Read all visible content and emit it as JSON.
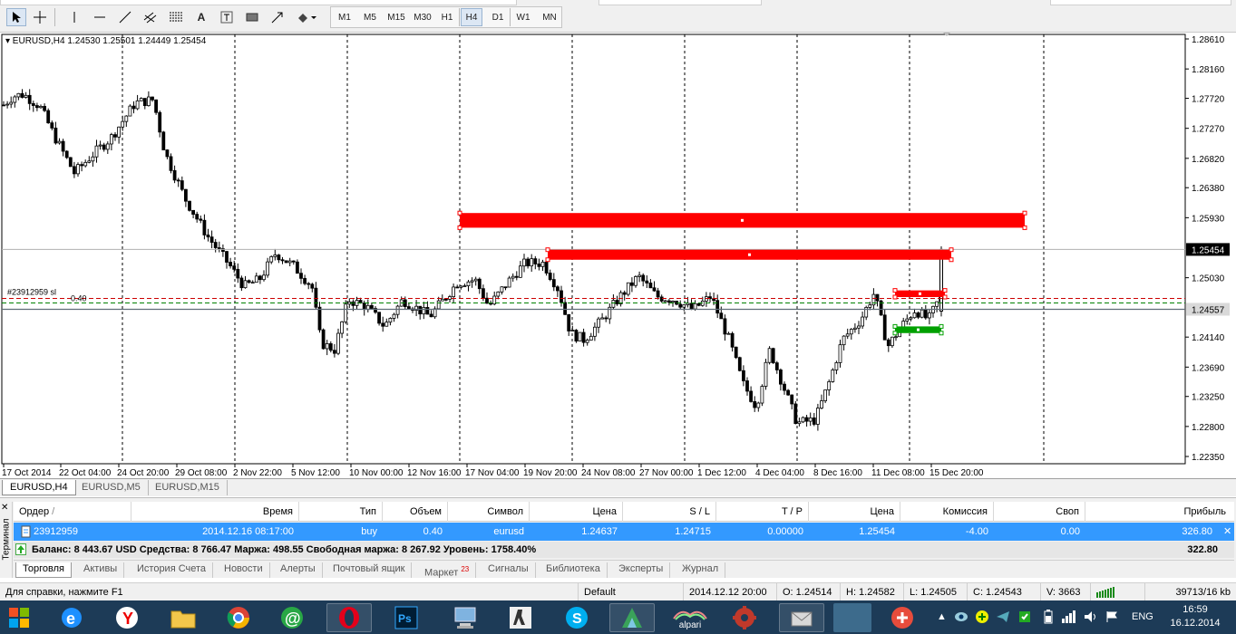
{
  "toolbar": {
    "timeframes": [
      "M1",
      "M5",
      "M15",
      "M30",
      "H1",
      "H4",
      "D1",
      "W1",
      "MN"
    ],
    "selected_timeframe": "H4"
  },
  "chart": {
    "info": "EURUSD,H4  1.24530 1.25501 1.24449 1.25454",
    "price_labels": [
      "1.28610",
      "1.28160",
      "1.27720",
      "1.27270",
      "1.26820",
      "1.26380",
      "1.25930",
      "1.25030",
      "1.24140",
      "1.23690",
      "1.23250",
      "1.22800",
      "1.22350"
    ],
    "current_price": "1.25454",
    "line_price": "1.24557",
    "date_labels": [
      "17 Oct 2014",
      "22 Oct 04:00",
      "24 Oct 20:00",
      "29 Oct 08:00",
      "2 Nov 22:00",
      "5 Nov 12:00",
      "10 Nov 00:00",
      "12 Nov 16:00",
      "17 Nov 04:00",
      "19 Nov 20:00",
      "24 Nov 08:00",
      "27 Nov 00:00",
      "1 Dec 12:00",
      "4 Dec 04:00",
      "8 Dec 16:00",
      "11 Dec 08:00",
      "15 Dec 20:00"
    ],
    "order_label": "#23912959 sl",
    "order_lot": "0.40",
    "colors": {
      "bull_body": "#ffffff",
      "bear_body": "#000000",
      "zone": "#ff0000",
      "zone_green": "#00a000",
      "order_line": "#008000",
      "stop_line": "#cc0000"
    }
  },
  "chart_tabs": [
    "EURUSD,H4",
    "EURUSD,M5",
    "EURUSD,M15"
  ],
  "terminal": {
    "side_label": "Терминал",
    "columns": {
      "order": "Ордер",
      "time": "Время",
      "type": "Тип",
      "volume": "Объем",
      "symbol": "Символ",
      "price": "Цена",
      "sl": "S / L",
      "tp": "T / P",
      "price2": "Цена",
      "commission": "Комиссия",
      "swap": "Своп",
      "profit": "Прибыль"
    },
    "row": {
      "order": "23912959",
      "time": "2014.12.16 08:17:00",
      "type": "buy",
      "volume": "0.40",
      "symbol": "eurusd",
      "price": "1.24637",
      "sl": "1.24715",
      "tp": "0.00000",
      "price2": "1.25454",
      "commission": "-4.00",
      "swap": "0.00",
      "profit": "326.80"
    },
    "balance_line": "Баланс: 8 443.67 USD  Средства: 8 766.47  Маржа: 498.55  Свободная маржа: 8 267.92  Уровень: 1758.40%",
    "balance_profit": "322.80",
    "tabs": [
      "Торговля",
      "Активы",
      "История Счета",
      "Новости",
      "Алерты",
      "Почтовый ящик",
      "Маркет",
      "Сигналы",
      "Библиотека",
      "Эксперты",
      "Журнал"
    ],
    "market_badge": "23"
  },
  "status": {
    "help": "Для справки, нажмите F1",
    "profile": "Default",
    "datetime": "2014.12.12 20:00",
    "open": "O: 1.24514",
    "high": "H: 1.24582",
    "low": "L: 1.24505",
    "close": "C: 1.24543",
    "volume": "V: 3663",
    "traffic": "39713/16 kb"
  },
  "taskbar": {
    "alpari_label": "alpari",
    "lang": "ENG",
    "time": "16:59",
    "date": "16.12.2014"
  }
}
